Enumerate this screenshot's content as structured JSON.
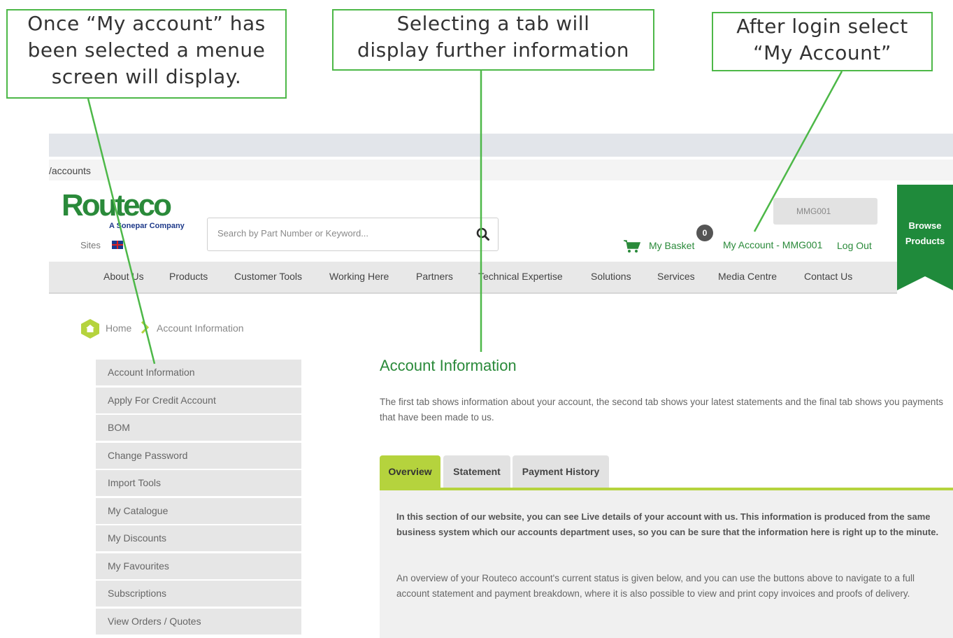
{
  "annotations": {
    "menu": [
      "Once “My account” has",
      "been selected a menue",
      "screen will display."
    ],
    "tab": [
      "Selecting a tab will",
      "display further information"
    ],
    "account": [
      "After login select",
      "“My Account”"
    ]
  },
  "browser": {
    "url": "/accounts"
  },
  "header": {
    "logo": "Routeco",
    "logo_sub": "A Sonepar Company",
    "sites_label": "Sites",
    "search_placeholder": "Search by Part Number or Keyword...",
    "account_code": "MMG001",
    "basket_label": "My Basket",
    "basket_count": "0",
    "my_account_label": "My Account - MMG001",
    "logout_label": "Log Out",
    "browse_line1": "Browse",
    "browse_line2": "Products"
  },
  "nav": [
    "About Us",
    "Products",
    "Customer Tools",
    "Working Here",
    "Partners",
    "Technical Expertise",
    "Solutions",
    "Services",
    "Media Centre",
    "Contact Us"
  ],
  "breadcrumb": {
    "home": "Home",
    "current": "Account Information"
  },
  "sidebar": [
    "Account Information",
    "Apply For Credit Account",
    "BOM",
    "Change Password",
    "Import Tools",
    "My Catalogue",
    "My Discounts",
    "My Favourites",
    "Subscriptions",
    "View Orders / Quotes"
  ],
  "main": {
    "title": "Account Information",
    "description": "The first tab shows information about your account, the second tab shows your latest statements and the final tab shows you payments that have been made to us.",
    "tabs": [
      "Overview",
      "Statement",
      "Payment History"
    ],
    "panel_bold": "In this section of our website, you can see Live details of your account with us. This information is produced from the same business system which our accounts department uses, so you can be sure that the information here is right up to the minute.",
    "panel_text": "An overview of your Routeco account's current status is given below, and you can use the buttons above to navigate to a full account statement and payment breakdown, where it is also possible to view and print copy invoices and proofs of delivery."
  },
  "colors": {
    "annotation_border": "#4db848",
    "brand_green": "#2a8a3a",
    "tab_active": "#b5d33d",
    "browse_ribbon": "#1f8a3b"
  }
}
